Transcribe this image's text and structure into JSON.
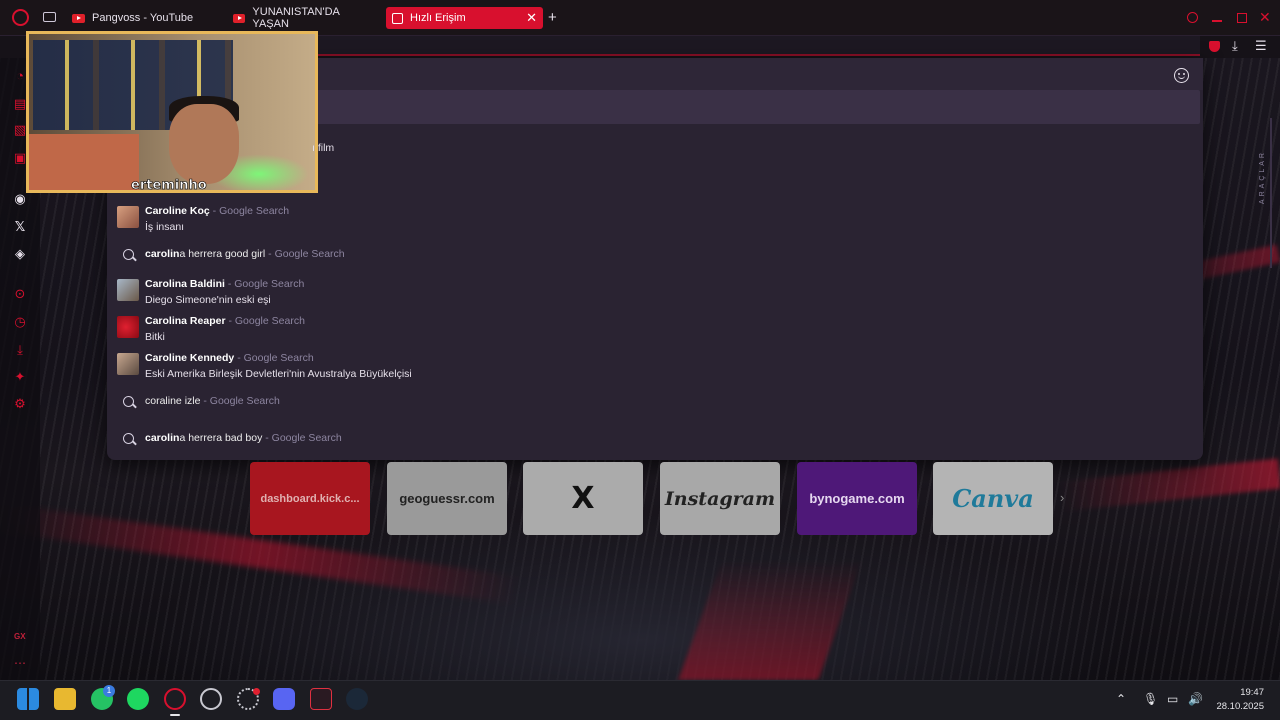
{
  "tabs": [
    {
      "label": "Pangvoss - YouTube"
    },
    {
      "label": "YUNANİSTAN'DA YAŞAN"
    },
    {
      "label": "Hızlı Erişim",
      "close": "✕"
    }
  ],
  "new_tab": "+",
  "webcam": {
    "name": "erteminho",
    "overflow_text": "ı film"
  },
  "suggestions": [
    {
      "bold": "Caroline Koç",
      "rest": "",
      "source": " - Google Search",
      "sub": "İş insanı"
    },
    {
      "bold": "carolin",
      "rest": "a herrera good girl",
      "source": " - Google Search",
      "sub": ""
    },
    {
      "bold": "Carolina Baldini",
      "rest": "",
      "source": " - Google Search",
      "sub": "Diego Simeone'nin eski eşi"
    },
    {
      "bold": "Carolina Reaper",
      "rest": "",
      "source": " - Google Search",
      "sub": "Bitki"
    },
    {
      "bold": "Caroline Kennedy",
      "rest": "",
      "source": " - Google Search",
      "sub": "Eski Amerika Birleşik Devletleri'nin Avustralya Büyükelçisi"
    },
    {
      "bold": "",
      "rest": "coraline izle",
      "source": " - Google Search",
      "sub": ""
    },
    {
      "bold": "carolin",
      "rest": "a herrera bad boy",
      "source": " - Google Search",
      "sub": ""
    }
  ],
  "speed_dial": [
    {
      "label": "dashboard.kick.c...",
      "bg": "#b01a22",
      "fg": "#e8c0c0"
    },
    {
      "label": "geoguessr.com",
      "bg": "#9a9a9a",
      "fg": "#222"
    },
    {
      "label": "X",
      "bg": "#ababab",
      "fg": "#111"
    },
    {
      "label": "Instagram",
      "bg": "#a8a8a8",
      "fg": "#222"
    },
    {
      "label": "bynogame.com",
      "bg": "#5a1a8a",
      "fg": "#e6d8f0"
    },
    {
      "label": "Canva",
      "bg": "#b4b4b4",
      "fg": "#1f7a9a"
    }
  ],
  "sidebar_label": "ARAÇLAR",
  "sidebar_gx": "GX",
  "taskbar": {
    "time": "19:47",
    "date": "28.10.2025",
    "whatsapp_badge": "1"
  },
  "colors": {
    "accent": "#d8102e",
    "panel": "#2a2332",
    "highlight": "#3a3046"
  }
}
